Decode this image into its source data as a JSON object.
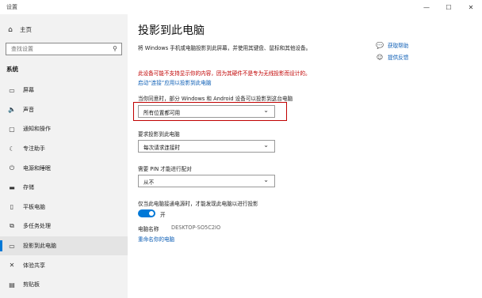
{
  "window": {
    "title": "设置",
    "controls": {
      "minimize": "—",
      "maximize": "☐",
      "close": "✕"
    }
  },
  "sidebar": {
    "home_label": "主页",
    "home_icon": "home-icon",
    "search_placeholder": "查找设置",
    "section_label": "系统",
    "items": [
      {
        "label": "屏幕",
        "icon": "monitor-icon",
        "glyph": "▭"
      },
      {
        "label": "声音",
        "icon": "speaker-icon",
        "glyph": "🔈"
      },
      {
        "label": "通知和操作",
        "icon": "notification-icon",
        "glyph": "▢"
      },
      {
        "label": "专注助手",
        "icon": "moon-icon",
        "glyph": "☾"
      },
      {
        "label": "电源和睡眠",
        "icon": "power-icon",
        "glyph": "⏻"
      },
      {
        "label": "存储",
        "icon": "storage-icon",
        "glyph": "▬"
      },
      {
        "label": "平板电脑",
        "icon": "tablet-icon",
        "glyph": "▯"
      },
      {
        "label": "多任务处理",
        "icon": "multitask-icon",
        "glyph": "⧉"
      },
      {
        "label": "投影到此电脑",
        "icon": "projector-icon",
        "glyph": "▭",
        "active": true
      },
      {
        "label": "体验共享",
        "icon": "share-icon",
        "glyph": "✕"
      },
      {
        "label": "剪贴板",
        "icon": "clipboard-icon",
        "glyph": "▤"
      }
    ]
  },
  "main": {
    "title": "投影到此电脑",
    "description": "将 Windows 手机或电脑投影到此屏幕，并使用其键盘、鼠标和其他设备。",
    "warning": "此设备可能不支持显示你的内容，因为其硬件不是专为无线投影而设计的。",
    "enable_link": "启动“连接”应用以投影到此电脑",
    "q1_label": "当你同意时，部分 Windows 和 Android 设备可以投影到这台电脑",
    "q1_value": "所有位置都可用",
    "q2_label": "要求投影到此电脑",
    "q2_value": "每次请求连接时",
    "q3_label": "需要 PIN 才能进行配对",
    "q3_value": "从不",
    "power_label": "仅当此电脑接通电源时，才能发现此电脑以进行投影",
    "toggle_label": "开",
    "toggle_on": true,
    "pc_name_label": "电脑名称",
    "pc_name_value": "DESKTOP-SO5C2IO",
    "rename_link": "重命名你的电脑"
  },
  "help": {
    "get_help": "获取帮助",
    "feedback": "提供反馈"
  },
  "colors": {
    "accent": "#0078d7",
    "warning": "#c00000",
    "link": "#0a5cb5",
    "sidebar_bg": "#f2f2f2"
  }
}
